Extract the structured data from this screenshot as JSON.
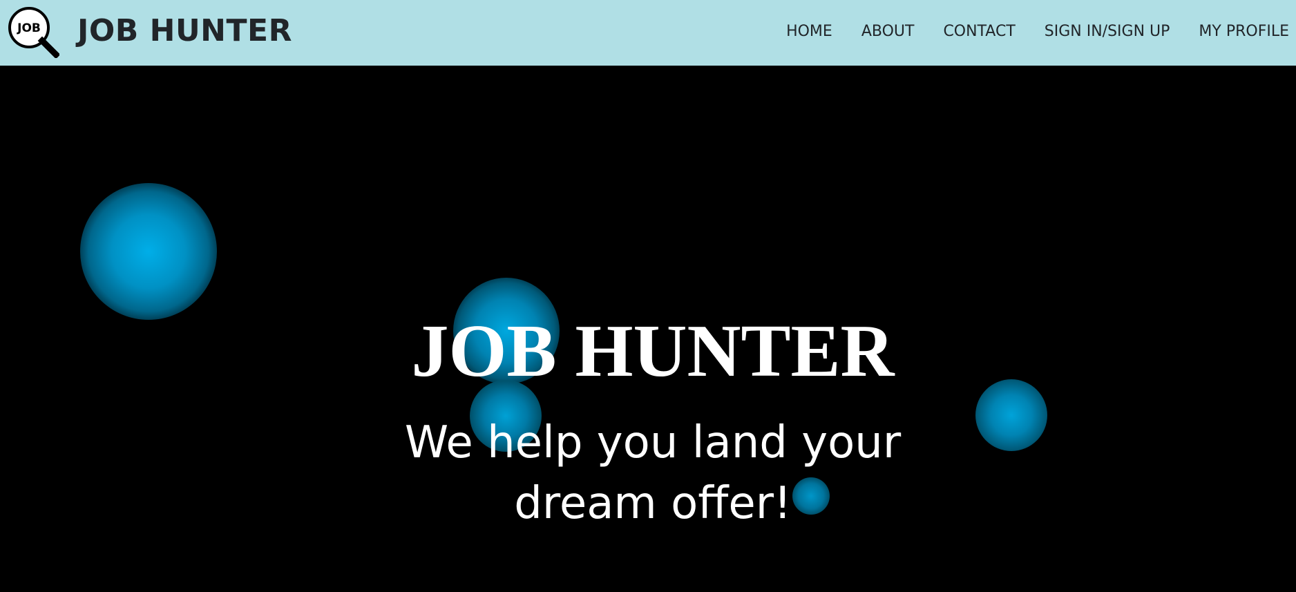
{
  "header": {
    "logo_text": "JOB",
    "brand": "JOB HUNTER",
    "nav": [
      {
        "label": "HOME"
      },
      {
        "label": "ABOUT"
      },
      {
        "label": "CONTACT"
      },
      {
        "label": "SIGN IN/SIGN UP"
      },
      {
        "label": "MY PROFILE"
      }
    ],
    "background_color": "#b0dfe5",
    "logo_icon": "magnifying-glass-icon"
  },
  "hero": {
    "title": "JOB HUNTER",
    "subtitle": "We help you land your dream offer!",
    "background_color": "#000000",
    "orb_color": "#00aee8"
  }
}
